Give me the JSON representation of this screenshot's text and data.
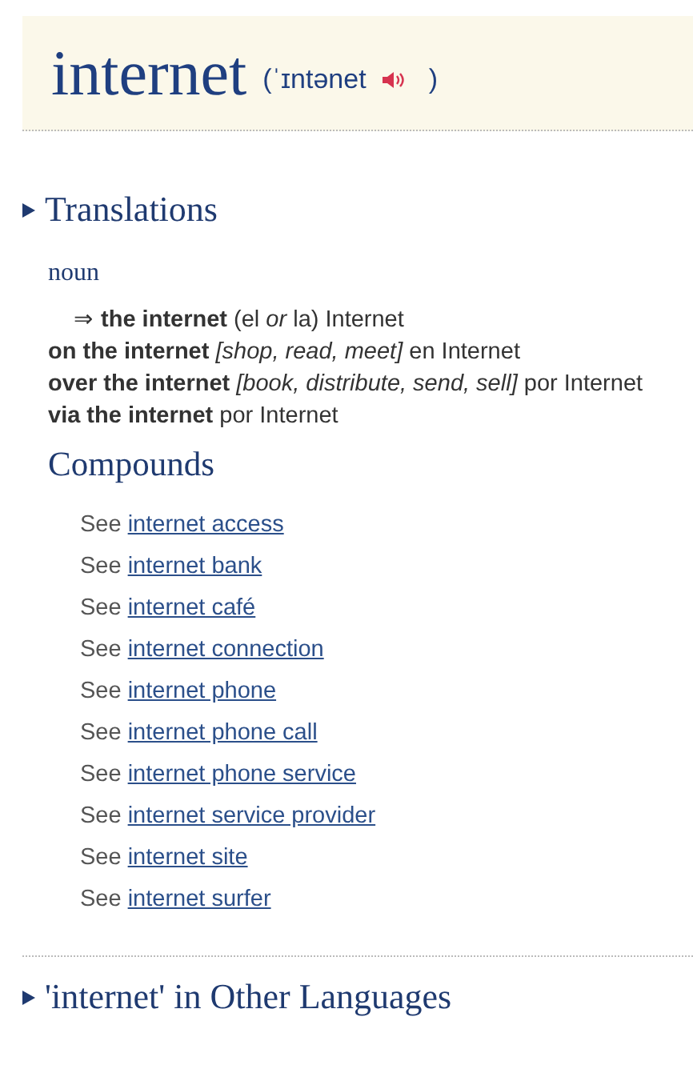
{
  "headword": {
    "word": "internet",
    "pronunciation_open": "(ˈɪntənet",
    "pronunciation_close": ")"
  },
  "translations": {
    "heading": "Translations",
    "part_of_speech": "noun",
    "main_entry": "⇒ **the internet** (el *or* la) Internet",
    "phrases": [
      "**on the internet** *[shop, read, meet]* en Internet",
      "**over the internet** *[book, distribute, send, sell]* por Internet",
      "**via the internet** por Internet"
    ]
  },
  "compounds": {
    "heading": "Compounds",
    "items": [
      {
        "prefix": "See",
        "link": "internet access"
      },
      {
        "prefix": "See",
        "link": "internet bank"
      },
      {
        "prefix": "See",
        "link": "internet café"
      },
      {
        "prefix": "See",
        "link": "internet connection"
      },
      {
        "prefix": "See",
        "link": "internet phone"
      },
      {
        "prefix": "See",
        "link": "internet phone call"
      },
      {
        "prefix": "See",
        "link": "internet phone service"
      },
      {
        "prefix": "See",
        "link": "internet service provider"
      },
      {
        "prefix": "See",
        "link": "internet site"
      },
      {
        "prefix": "See",
        "link": "internet surfer"
      }
    ]
  },
  "other_languages": {
    "heading": "'internet' in Other Languages"
  }
}
